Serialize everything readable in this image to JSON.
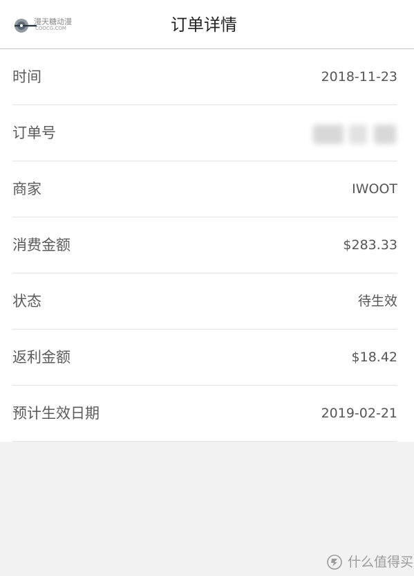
{
  "header": {
    "title": "订单详情",
    "logo_text": "漫天糖动漫",
    "logo_sub": "COOCG.COM"
  },
  "rows": [
    {
      "label": "时间",
      "value": "2018-11-23"
    },
    {
      "label": "订单号",
      "value": ""
    },
    {
      "label": "商家",
      "value": "IWOOT"
    },
    {
      "label": "消费金额",
      "value": "$283.33"
    },
    {
      "label": "状态",
      "value": "待生效"
    },
    {
      "label": "返利金额",
      "value": "$18.42"
    },
    {
      "label": "预计生效日期",
      "value": "2019-02-21"
    }
  ],
  "watermark": {
    "icon": "smzdm-logo-icon",
    "text": "什么值得买"
  }
}
